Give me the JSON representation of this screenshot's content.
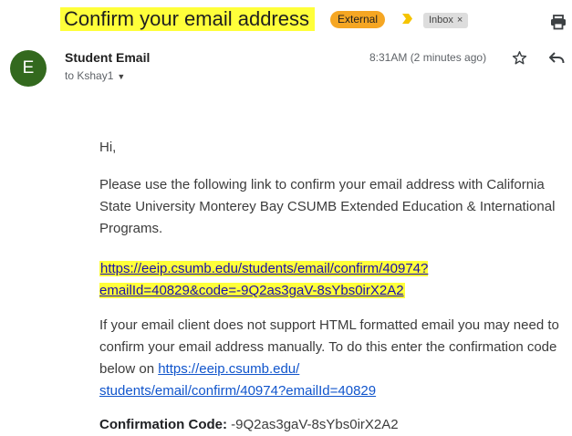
{
  "header": {
    "subject": "Confirm your email address",
    "labels": {
      "external": "External",
      "inbox": "Inbox",
      "inbox_remove": "×"
    },
    "icons": {
      "important": "important-marker-icon",
      "print": "print-icon"
    },
    "colors": {
      "highlight": "#ffff3a",
      "external": "#f5a623",
      "avatar": "#33691e"
    }
  },
  "message": {
    "avatar_letter": "E",
    "sender": "Student Email",
    "to": "to Kshay1",
    "time": "8:31AM (2 minutes ago)",
    "icons": {
      "star": "star-icon",
      "reply": "reply-icon",
      "caret": "caret-down-icon"
    }
  },
  "body": {
    "greeting": "Hi,",
    "para1": "Please use the following link to confirm your email address with California State University Monterey Bay CSUMB Extended Education & International Programs.",
    "confirm_link_line1": "https://eeip.csumb.edu/students/email/confirm/40974?",
    "confirm_link_line2": "emailId=40829&code=-9Q2as3gaV-8sYbs0irX2A2",
    "para2_text": "If your email client does not support HTML formatted email you may need to confirm your email address manually. To do this enter the confirmation code below on ",
    "para2_link_line1": "https://eeip.csumb.edu/",
    "para2_link_line2": "students/email/confirm/40974?emailId=40829",
    "code_label": "Confirmation Code:",
    "code_value": " -9Q2as3gaV-8sYbs0irX2A2"
  }
}
